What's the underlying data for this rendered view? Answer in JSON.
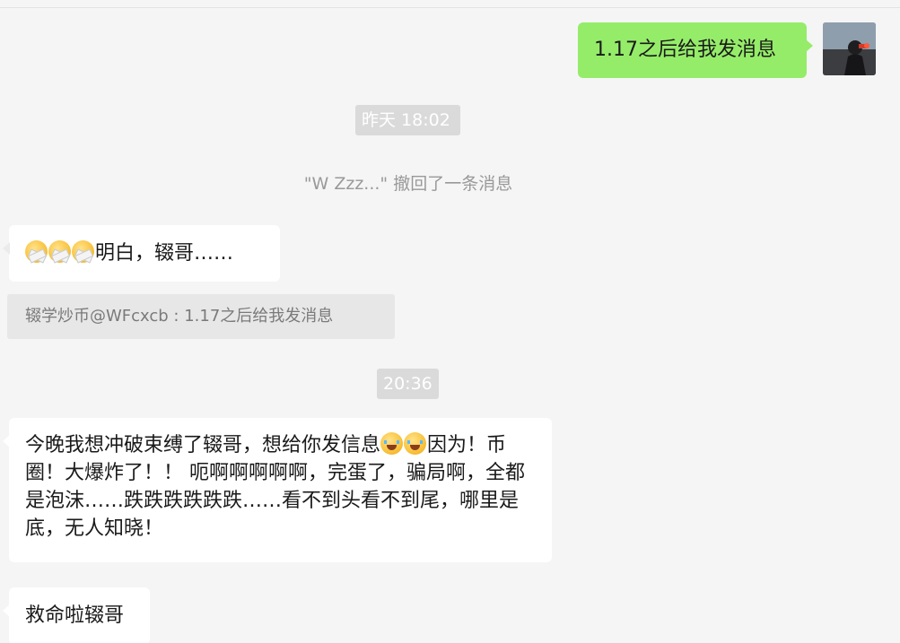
{
  "messages": {
    "sent_top": "1.17之后给我发消息",
    "recv_first_text": "明白，辍哥……",
    "recv_long_lead": "今晚我想冲破束缚了辍哥，想给你发信息",
    "recv_long_tail": "因为！币圈！大爆炸了！！ 呃啊啊啊啊啊，完蛋了，骗局啊，全都是泡沫……跌跌跌跌跌跌……看不到头看不到尾，哪里是底，无人知晓！",
    "recv_last": "救命啦辍哥"
  },
  "timestamps": {
    "first": "昨天 18:02",
    "second": "20:36"
  },
  "system": {
    "recall_notice": "\"W Zzz...\" 撤回了一条消息"
  },
  "quote": {
    "text": "辍学炒币@WFcxcb : 1.17之后给我发消息"
  },
  "icons": {
    "tape_emoji": "mouth-taped-emoji",
    "cry_emoji": "crying-emoji"
  },
  "colors": {
    "self_bubble": "#95ec69",
    "other_bubble": "#ffffff",
    "background": "#f5f5f5",
    "timestamp_bg": "#dadada"
  }
}
